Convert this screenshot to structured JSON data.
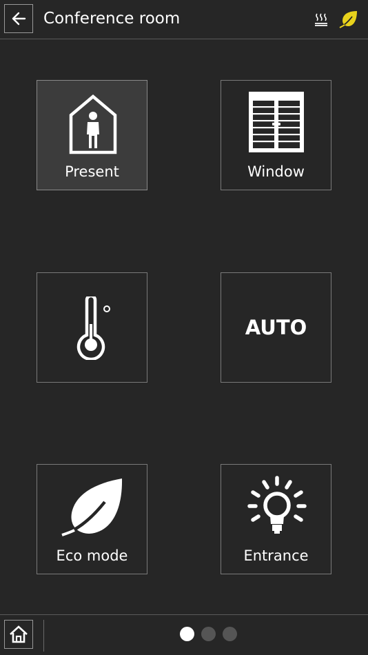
{
  "header": {
    "title": "Conference room",
    "back_icon": "arrow-left-icon",
    "status_icons": [
      "heating-icon",
      "leaf-icon"
    ],
    "leaf_color": "#e8d21c"
  },
  "tiles": [
    {
      "label": "Present",
      "icon": "person-in-house-icon",
      "active": true
    },
    {
      "label": "Window",
      "icon": "window-blinds-icon",
      "active": false
    },
    {
      "label": "",
      "icon": "thermometer-icon",
      "active": false
    },
    {
      "label": "AUTO",
      "icon": "",
      "active": false
    },
    {
      "label": "Eco mode",
      "icon": "leaf-icon",
      "active": false
    },
    {
      "label": "Entrance",
      "icon": "light-bulb-icon",
      "active": false
    }
  ],
  "footer": {
    "home_icon": "home-icon",
    "pages": 3,
    "current_page": 1
  }
}
